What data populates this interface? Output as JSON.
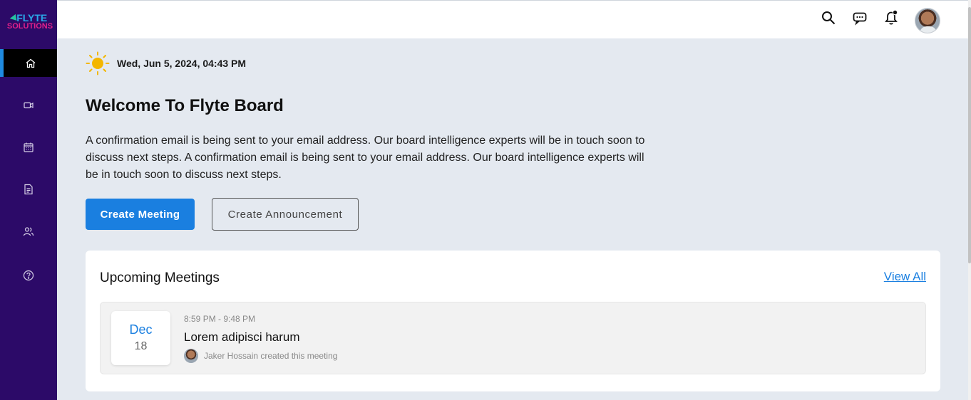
{
  "logo": {
    "line1": "FLYTE",
    "line2": "SOLUTIONS"
  },
  "sidebar": {
    "items": [
      {
        "name": "home",
        "icon": "home-icon",
        "active": true
      },
      {
        "name": "video",
        "icon": "video-icon",
        "active": false
      },
      {
        "name": "calendar",
        "icon": "calendar-icon",
        "active": false
      },
      {
        "name": "documents",
        "icon": "document-icon",
        "active": false
      },
      {
        "name": "users",
        "icon": "users-icon",
        "active": false
      },
      {
        "name": "help",
        "icon": "help-icon",
        "active": false
      }
    ]
  },
  "topbar": {
    "icons": [
      "search-icon",
      "chat-icon",
      "bell-icon"
    ],
    "notification_dot": true
  },
  "header": {
    "date": "Wed, Jun 5, 2024, 04:43 PM"
  },
  "main": {
    "welcome": "Welcome To Flyte Board",
    "description": "A confirmation email is being sent to your email address. Our board intelligence experts will be in touch soon to discuss next steps. A confirmation email is being sent to your email address. Our board intelligence experts will be in touch soon to discuss next steps.",
    "create_meeting_label": "Create Meeting",
    "create_announcement_label": "Create Announcement"
  },
  "upcoming": {
    "title": "Upcoming Meetings",
    "view_all": "View All",
    "meetings": [
      {
        "month": "Dec",
        "day": "18",
        "time": "8:59 PM - 9:48 PM",
        "title": "Lorem adipisci harum",
        "creator": "Jaker Hossain created this meeting"
      }
    ]
  },
  "colors": {
    "sidebar": "#2c0a68",
    "accent": "#1a7fe0",
    "background": "#e4e9f0"
  }
}
